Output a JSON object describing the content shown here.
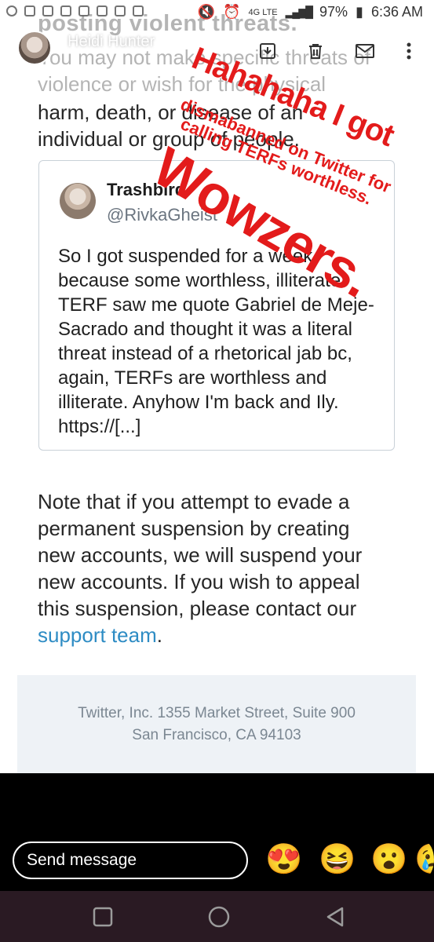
{
  "status_bar": {
    "battery": "97%",
    "time": "6:36 AM",
    "network": "4G LTE"
  },
  "story": {
    "author": "Heidi Hunter"
  },
  "email": {
    "faded_heading": "posting violent threats.",
    "faded_line1": "You may not make specific threats of",
    "faded_line2": "violence or wish for the physical",
    "line1": "harm, death, or disease of an",
    "line2": "individual or group of people.",
    "tweet": {
      "name": "Trashbird",
      "handle": "@RivkaGheist",
      "lines": [
        "So I got suspended for a week",
        "because some worthless, illiterate",
        "TERF saw me quote Gabriel de Meje-",
        "Sacrado and thought it was a literal",
        "threat instead of a rhetorical jab bc,",
        "again, TERFs are worthless and",
        "illiterate. Anyhow I'm back and Ily.",
        "https://[...]"
      ]
    },
    "note_lines": [
      "Note that if you attempt to evade a",
      "permanent suspension by creating",
      "new accounts, we will suspend your",
      "new accounts. If you wish to appeal",
      "this suspension, please contact our"
    ],
    "support_link": "support team",
    "support_suffix": ".",
    "footer_line1": "Twitter, Inc. 1355 Market Street, Suite 900",
    "footer_line2": "San Francisco, CA 94103"
  },
  "overlay": {
    "line1": "Hahahaha I got",
    "line2": "dismabanned on Twitter for",
    "line3": "calling TERFs worthless.",
    "line4": "Wowzers."
  },
  "message_bar": {
    "placeholder": "Send message",
    "emojis": [
      "😍",
      "😆",
      "😮",
      "😢"
    ]
  },
  "colors": {
    "overlay_red": "#e31b1b",
    "link_blue": "#2e8cc4",
    "nav_bg": "#2a1a23"
  }
}
